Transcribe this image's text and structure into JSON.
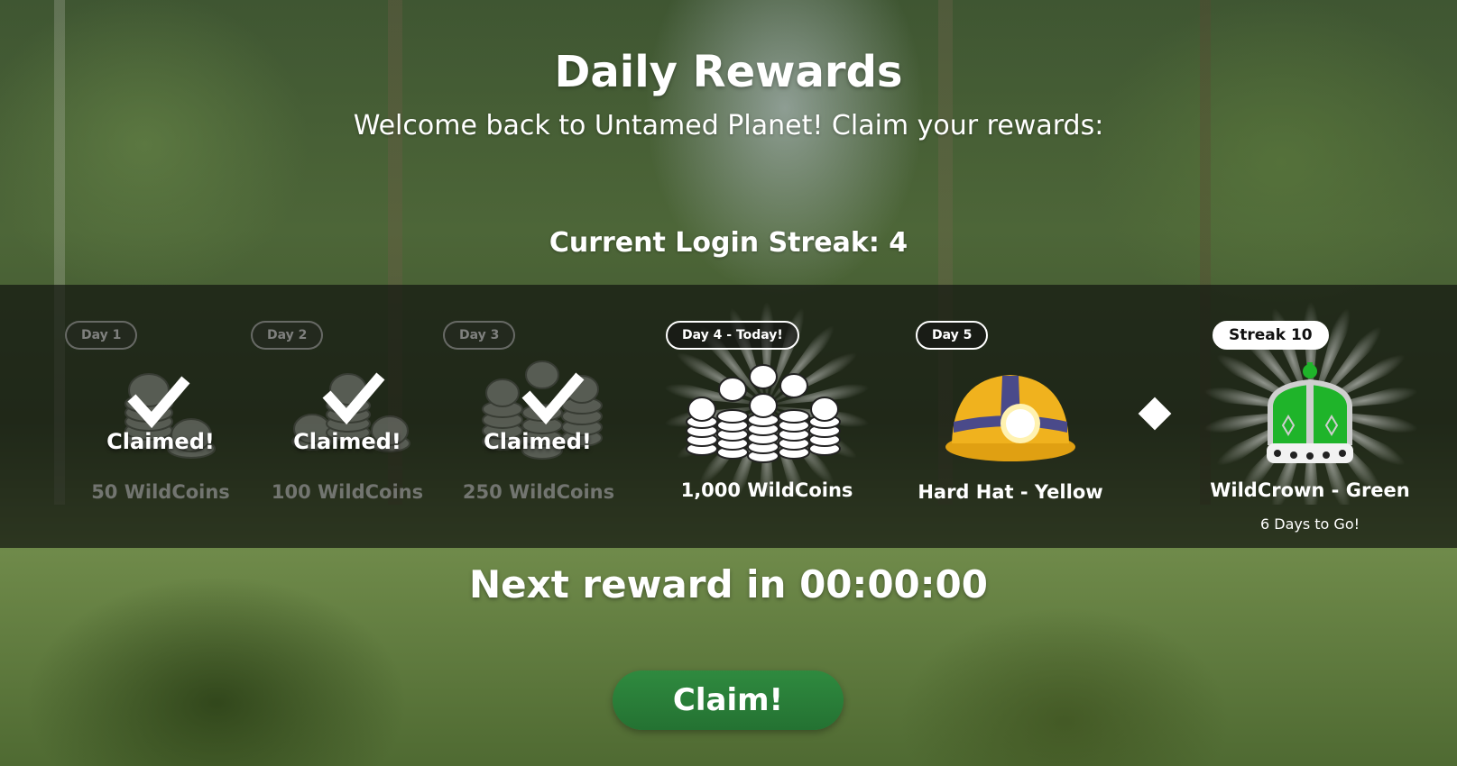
{
  "header": {
    "title": "Daily Rewards",
    "subtitle": "Welcome back to Untamed Planet! Claim your rewards:",
    "streak": "Current Login Streak: 4"
  },
  "rewards": [
    {
      "badge": "Day 1",
      "status": "Claimed!",
      "name": "50 WildCoins",
      "icon": "coin-stack-icon"
    },
    {
      "badge": "Day 2",
      "status": "Claimed!",
      "name": "100 WildCoins",
      "icon": "coin-stack-icon"
    },
    {
      "badge": "Day 3",
      "status": "Claimed!",
      "name": "250 WildCoins",
      "icon": "coin-stack-icon"
    },
    {
      "badge": "Day 4 - Today!",
      "name": "1,000 WildCoins",
      "icon": "coin-pile-icon"
    },
    {
      "badge": "Day 5",
      "name": "Hard Hat - Yellow",
      "icon": "hard-hat-icon"
    },
    {
      "badge": "Streak 10",
      "name": "WildCrown - Green",
      "sub": "6 Days to Go!",
      "icon": "crown-icon"
    }
  ],
  "footer": {
    "next_reward": "Next reward in 00:00:00",
    "claim_label": "Claim!"
  },
  "colors": {
    "claim_button": "#2f8a3f",
    "hat_yellow": "#f0b21e",
    "hat_band": "#4a4a8a",
    "crown_green": "#1fb42a"
  }
}
